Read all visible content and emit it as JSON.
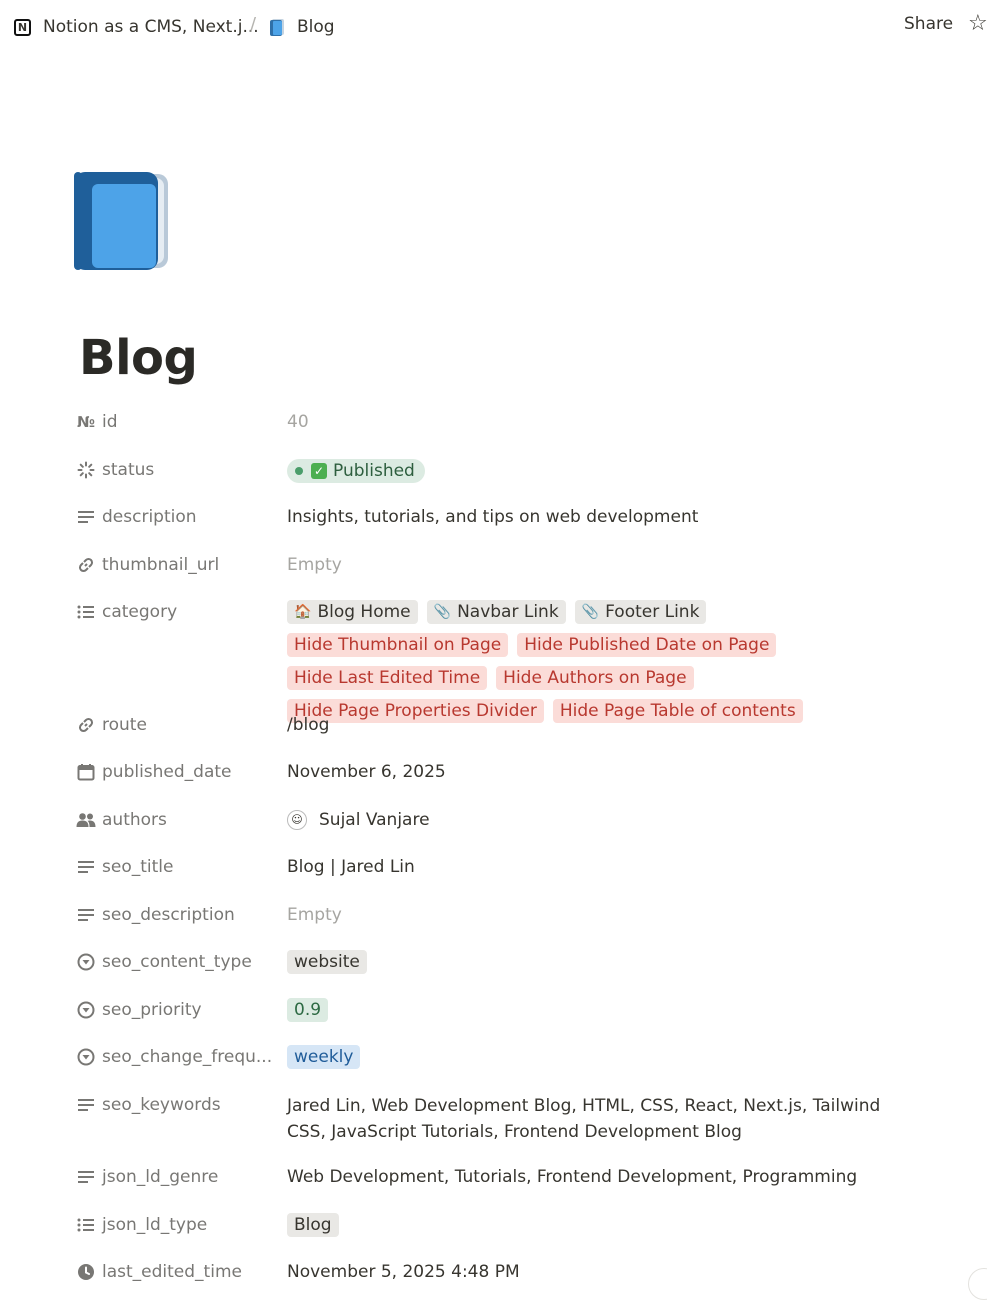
{
  "breadcrumb": {
    "workspace": "Notion as a CMS, Next.j...",
    "page": "Blog"
  },
  "topbar": {
    "share_label": "Share"
  },
  "page": {
    "title": "Blog",
    "icon": "blue-book-icon"
  },
  "props": {
    "id": {
      "label": "id",
      "value": "40"
    },
    "status": {
      "label": "status",
      "value": "Published"
    },
    "description": {
      "label": "description",
      "value": "Insights, tutorials, and tips on web development"
    },
    "thumbnail_url": {
      "label": "thumbnail_url",
      "value": "Empty"
    },
    "category": {
      "label": "category",
      "tags": [
        {
          "text": "Blog Home",
          "emoji": "🏠",
          "color": "gray"
        },
        {
          "text": "Navbar Link",
          "emoji": "📎",
          "color": "gray"
        },
        {
          "text": "Footer Link",
          "emoji": "📎",
          "color": "gray"
        },
        {
          "text": "Hide Thumbnail on Page",
          "color": "red"
        },
        {
          "text": "Hide Published Date on Page",
          "color": "red"
        },
        {
          "text": "Hide Last Edited Time",
          "color": "red"
        },
        {
          "text": "Hide Authors on Page",
          "color": "red"
        },
        {
          "text": "Hide Page Properties Divider",
          "color": "red"
        },
        {
          "text": "Hide Page Table of contents",
          "color": "red"
        }
      ]
    },
    "route": {
      "label": "route",
      "value": "/blog"
    },
    "published_date": {
      "label": "published_date",
      "value": "November 6, 2025"
    },
    "authors": {
      "label": "authors",
      "value": "Sujal Vanjare"
    },
    "seo_title": {
      "label": "seo_title",
      "value": "Blog | Jared Lin"
    },
    "seo_description": {
      "label": "seo_description",
      "value": "Empty"
    },
    "seo_content_type": {
      "label": "seo_content_type",
      "value": "website"
    },
    "seo_priority": {
      "label": "seo_priority",
      "value": "0.9"
    },
    "seo_change_frequency": {
      "label": "seo_change_frequ...",
      "value": "weekly"
    },
    "seo_keywords": {
      "label": "seo_keywords",
      "value": "Jared Lin, Web Development Blog, HTML, CSS, React, Next.js, Tailwind CSS, JavaScript Tutorials, Frontend Development Blog"
    },
    "json_ld_genre": {
      "label": "json_ld_genre",
      "value": "Web Development, Tutorials, Frontend Development, Programming"
    },
    "json_ld_type": {
      "label": "json_ld_type",
      "value": "Blog"
    },
    "last_edited_time": {
      "label": "last_edited_time",
      "value": "November 5, 2025 4:48 PM"
    }
  },
  "colors": {
    "tag_gray": "#e9e8e5",
    "tag_red": "#fbdcd8",
    "tag_green": "#dcebe2",
    "tag_blue": "#d6e6f6",
    "book_blue": "#4da3e8"
  }
}
